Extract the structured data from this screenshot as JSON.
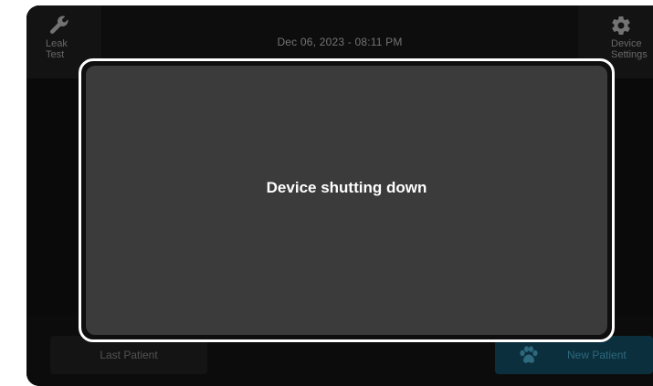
{
  "header": {
    "leak_test_label": "Leak\nTest",
    "leak_test_line1": "Leak",
    "leak_test_line2": "Test",
    "leak_test_icon": "wrench-icon",
    "settings_line1": "Device",
    "settings_line2": "Settings",
    "settings_icon": "gear-icon",
    "datetime": "Dec 06, 2023 - 08:11 PM"
  },
  "dialog": {
    "message": "Device shutting down"
  },
  "footer": {
    "last_patient_label": "Last Patient",
    "new_patient_label": "New Patient",
    "new_patient_icon": "paw-icon"
  },
  "colors": {
    "background": "#0e0e0e",
    "dialog_border": "#ffffff",
    "dialog_fill": "#3b3b3b",
    "new_patient_bg": "#0f3f52",
    "new_patient_text": "#3d8ba7"
  }
}
